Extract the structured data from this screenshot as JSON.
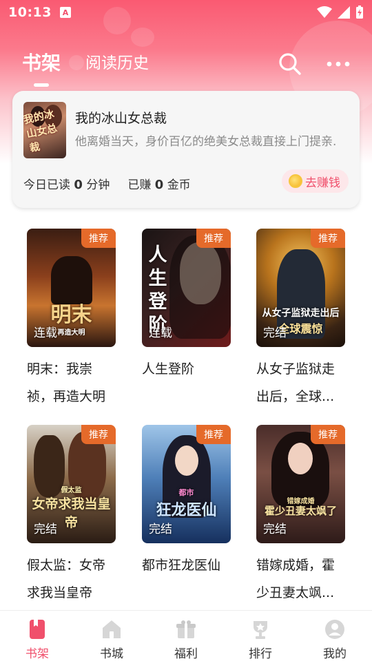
{
  "status_bar": {
    "time": "10:13",
    "app_icon_glyph": "A"
  },
  "top_nav": {
    "tabs": [
      {
        "label": "书架",
        "active": true
      },
      {
        "label": "阅读历史",
        "active": false
      }
    ],
    "search_icon": "search-icon",
    "more_icon": "more-horizontal-icon"
  },
  "reading_card": {
    "title": "我的冰山女总裁",
    "description": "他离婚当天，身价百亿的绝美女总裁直接上门提亲.",
    "cover_text": "我的冰山女总裁",
    "stat_read_prefix": "今日已读",
    "stat_read_value": "0",
    "stat_read_unit": "分钟",
    "stat_earn_prefix": "已赚",
    "stat_earn_value": "0",
    "stat_earn_unit": "金币",
    "earn_button": "去赚钱"
  },
  "books": [
    {
      "title": "明末：我崇祯，再造大明",
      "tag": "推荐",
      "status": "连载",
      "cover_text": "明末",
      "cover_sub": "再造大明"
    },
    {
      "title": "人生登阶",
      "tag": "推荐",
      "status": "连载",
      "cover_text": "人生登阶",
      "cover_sub": ""
    },
    {
      "title": "从女子监狱走出后，全球...",
      "tag": "推荐",
      "status": "完结",
      "cover_text": "从女子监狱走出后",
      "cover_sub": "全球震惊"
    },
    {
      "title": "假太监：女帝求我当皇帝",
      "tag": "推荐",
      "status": "完结",
      "cover_text": "女帝求我当皇帝",
      "cover_sub": "假太监"
    },
    {
      "title": "都市狂龙医仙",
      "tag": "推荐",
      "status": "完结",
      "cover_text": "狂龙医仙",
      "cover_sub": "都市"
    },
    {
      "title": "错嫁成婚，霍少丑妻太飒...",
      "tag": "推荐",
      "status": "完结",
      "cover_text": "霍少丑妻太飒了",
      "cover_sub": "错嫁成婚"
    }
  ],
  "bottom_nav": {
    "items": [
      {
        "label": "书架",
        "icon": "bookshelf-icon",
        "active": true
      },
      {
        "label": "书城",
        "icon": "bookstore-icon",
        "active": false
      },
      {
        "label": "福利",
        "icon": "gift-icon",
        "active": false
      },
      {
        "label": "排行",
        "icon": "trophy-icon",
        "active": false
      },
      {
        "label": "我的",
        "icon": "profile-icon",
        "active": false
      }
    ]
  },
  "colors": {
    "brand": "#f0506c",
    "header_top": "#fa5a72",
    "tag_orange": "#e56a2a"
  }
}
